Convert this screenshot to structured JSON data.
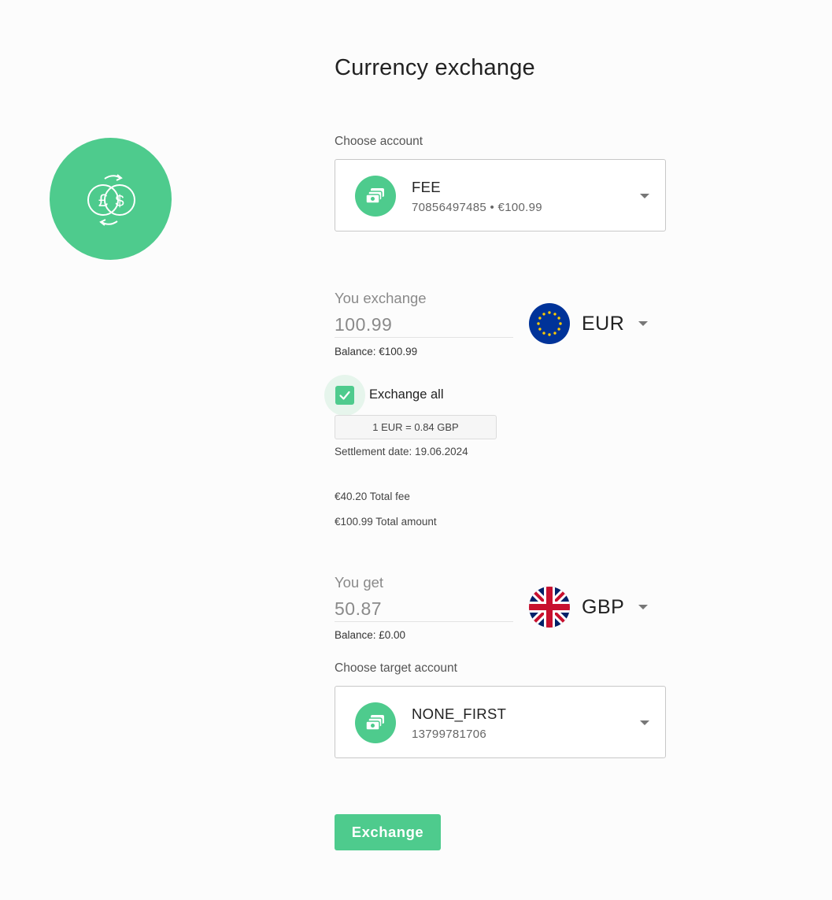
{
  "page": {
    "title": "Currency exchange",
    "hero_icon": "currency-exchange-icon",
    "accent_color": "#4ecb8d"
  },
  "source": {
    "label": "Choose account",
    "account_name": "FEE",
    "account_details": "70856497485 • €100.99",
    "amount_label": "You exchange",
    "amount_value": "100.99",
    "balance": "Balance: €100.99",
    "currency": "EUR",
    "flag_icon": "eu-flag-icon"
  },
  "exchange_all": {
    "label": "Exchange all",
    "checked": true
  },
  "rate": "1 EUR = 0.84 GBP",
  "settlement": "Settlement date: 19.06.2024",
  "total_fee": "€40.20 Total fee",
  "total_amount": "€100.99 Total amount",
  "target": {
    "amount_label": "You get",
    "amount_value": "50.87",
    "balance": "Balance: £0.00",
    "currency": "GBP",
    "flag_icon": "uk-flag-icon",
    "label": "Choose target account",
    "account_name": "NONE_FIRST",
    "account_details": "13799781706"
  },
  "actions": {
    "exchange_label": "Exchange"
  }
}
